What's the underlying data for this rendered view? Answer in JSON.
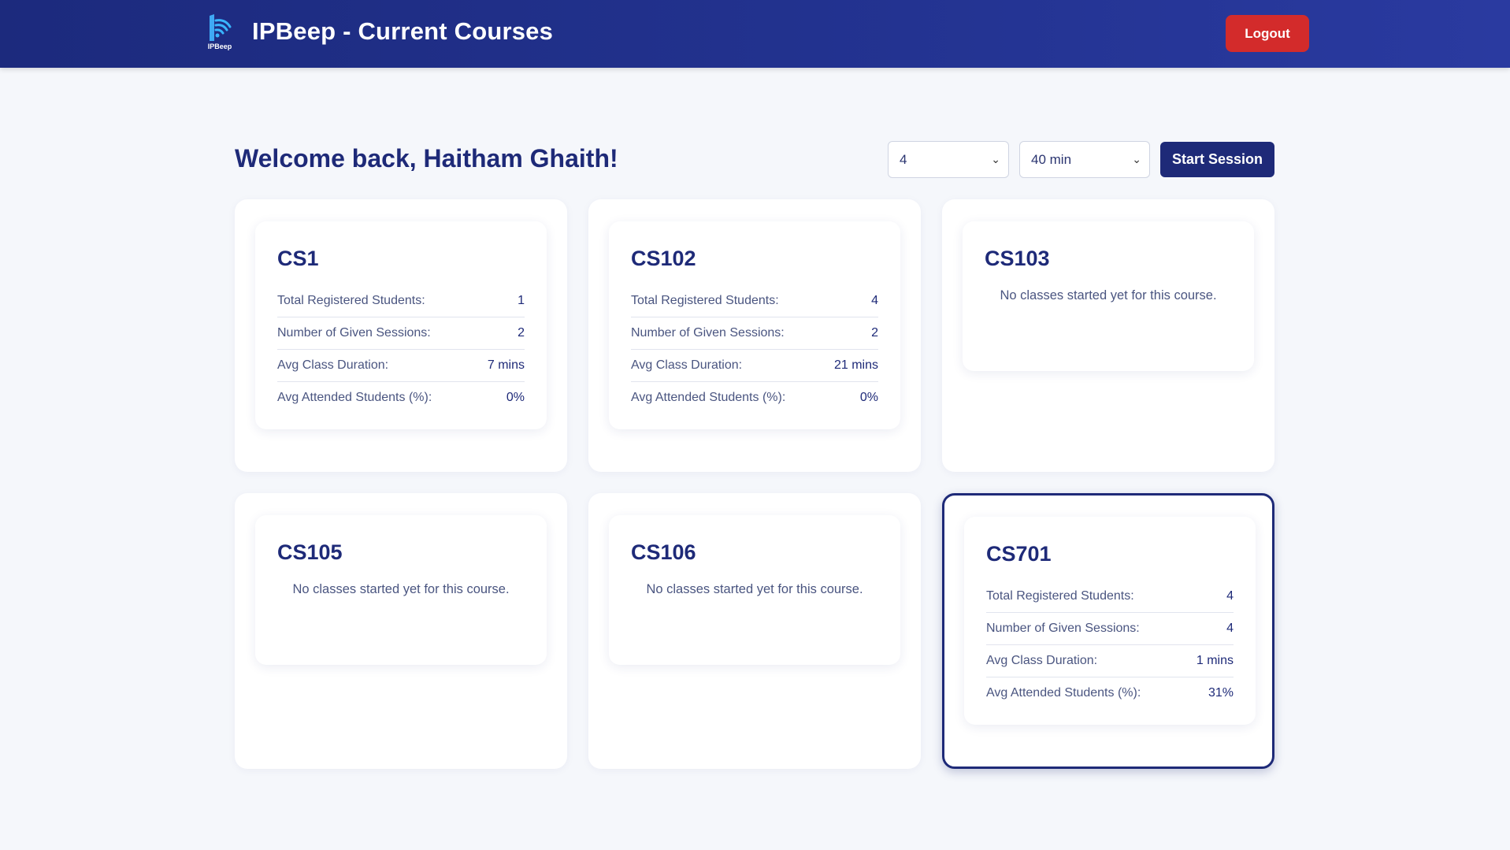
{
  "app": {
    "title": "IPBeep - Current Courses",
    "logo_text": "IPBeep",
    "logout_label": "Logout"
  },
  "welcome": "Welcome back, Haitham Ghaith!",
  "controls": {
    "count_value": "4",
    "duration_value": "40 min",
    "start_label": "Start Session"
  },
  "colors": {
    "header": "#233391",
    "accent": "#1e2a78",
    "logout": "#d32b2b"
  },
  "stat_labels": {
    "students": "Total Registered Students:",
    "sessions": "Number of Given Sessions:",
    "duration": "Avg Class Duration:",
    "attended": "Avg Attended Students (%):"
  },
  "empty_message": "No classes started yet for this course.",
  "courses": [
    {
      "code": "CS1",
      "students": "1",
      "sessions": "2",
      "duration": "7 mins",
      "attended": "0%"
    },
    {
      "code": "CS102",
      "students": "4",
      "sessions": "2",
      "duration": "21 mins",
      "attended": "0%"
    },
    {
      "code": "CS103"
    },
    {
      "code": "CS105"
    },
    {
      "code": "CS106"
    },
    {
      "code": "CS701",
      "students": "4",
      "sessions": "4",
      "duration": "1 mins",
      "attended": "31%"
    }
  ]
}
